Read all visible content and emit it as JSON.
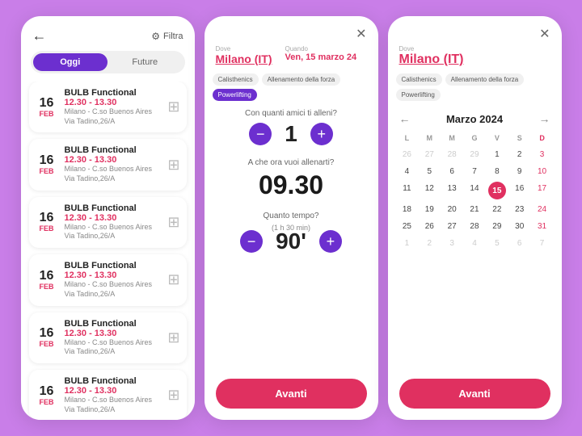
{
  "screen1": {
    "backLabel": "←",
    "filterLabel": "Filtra",
    "tabs": [
      {
        "label": "Oggi",
        "active": true
      },
      {
        "label": "Future",
        "active": false
      }
    ],
    "cards": [
      {
        "day": "16",
        "month": "Feb",
        "title": "BULB Functional",
        "time": "12.30 - 13.30",
        "location": "Milano - C.so Buenos Aires\nVia Tadino,26/A"
      },
      {
        "day": "16",
        "month": "Feb",
        "title": "BULB Functional",
        "time": "12.30 - 13.30",
        "location": "Milano - C.so Buenos Aires\nVia Tadino,26/A"
      },
      {
        "day": "16",
        "month": "Feb",
        "title": "BULB Functional",
        "time": "12.30 - 13.30",
        "location": "Milano - C.so Buenos Aires\nVia Tadino,26/A"
      },
      {
        "day": "16",
        "month": "Feb",
        "title": "BULB Functional",
        "time": "12.30 - 13.30",
        "location": "Milano - C.so Buenos Aires\nVia Tadino,26/A"
      },
      {
        "day": "16",
        "month": "Feb",
        "title": "BULB Functional",
        "time": "12.30 - 13.30",
        "location": "Milano - C.so Buenos Aires\nVia Tadino,26/A"
      },
      {
        "day": "16",
        "month": "Feb",
        "title": "BULB Functional",
        "time": "12.30 - 13.30",
        "location": "Milano - C.so Buenos Aires\nVia Tadino,26/A"
      }
    ]
  },
  "screen2": {
    "closeLabel": "✕",
    "dove": {
      "label": "Dove",
      "value": "Milano (IT)"
    },
    "quando": {
      "label": "Quando",
      "value": "Ven, 15 marzo 24"
    },
    "chips": [
      "Calisthenics",
      "Allenamento della forza",
      "Powerlifting"
    ],
    "friendsQuestion": "Con quanti amici ti alleni?",
    "friendsCount": "1",
    "timeQuestion": "A che ora vuoi allenarti?",
    "timeValue": "09.30",
    "durationQuestion": "Quanto tempo?",
    "durationSub": "(1 h 30 min)",
    "durationValue": "90'",
    "avantiLabel": "Avanti"
  },
  "screen3": {
    "closeLabel": "✕",
    "dove": {
      "label": "Dove",
      "value": "Milano (IT)"
    },
    "chips": [
      "Calisthenics",
      "Allenamento della forza",
      "Powerlifting"
    ],
    "calendar": {
      "monthLabel": "Marzo 2024",
      "prevLabel": "←",
      "nextLabel": "→",
      "weekDays": [
        "L",
        "M",
        "M",
        "G",
        "V",
        "S",
        "D"
      ],
      "weeks": [
        [
          "26",
          "27",
          "28",
          "29",
          "1",
          "2",
          "3"
        ],
        [
          "4",
          "5",
          "6",
          "7",
          "8",
          "9",
          "10"
        ],
        [
          "11",
          "12",
          "13",
          "14",
          "15",
          "16",
          "17"
        ],
        [
          "18",
          "19",
          "20",
          "21",
          "22",
          "23",
          "24"
        ],
        [
          "25",
          "26",
          "27",
          "28",
          "29",
          "30",
          "31"
        ],
        [
          "1",
          "2",
          "3",
          "4",
          "5",
          "6",
          "7"
        ]
      ],
      "todayIndex": [
        2,
        4
      ],
      "otherMonthRows": [
        [
          0,
          [
            0,
            1,
            2,
            3
          ]
        ],
        [
          4,
          []
        ],
        [
          5,
          [
            0,
            1,
            2,
            3,
            4,
            5,
            6
          ]
        ]
      ]
    },
    "avantiLabel": "Avanti"
  }
}
